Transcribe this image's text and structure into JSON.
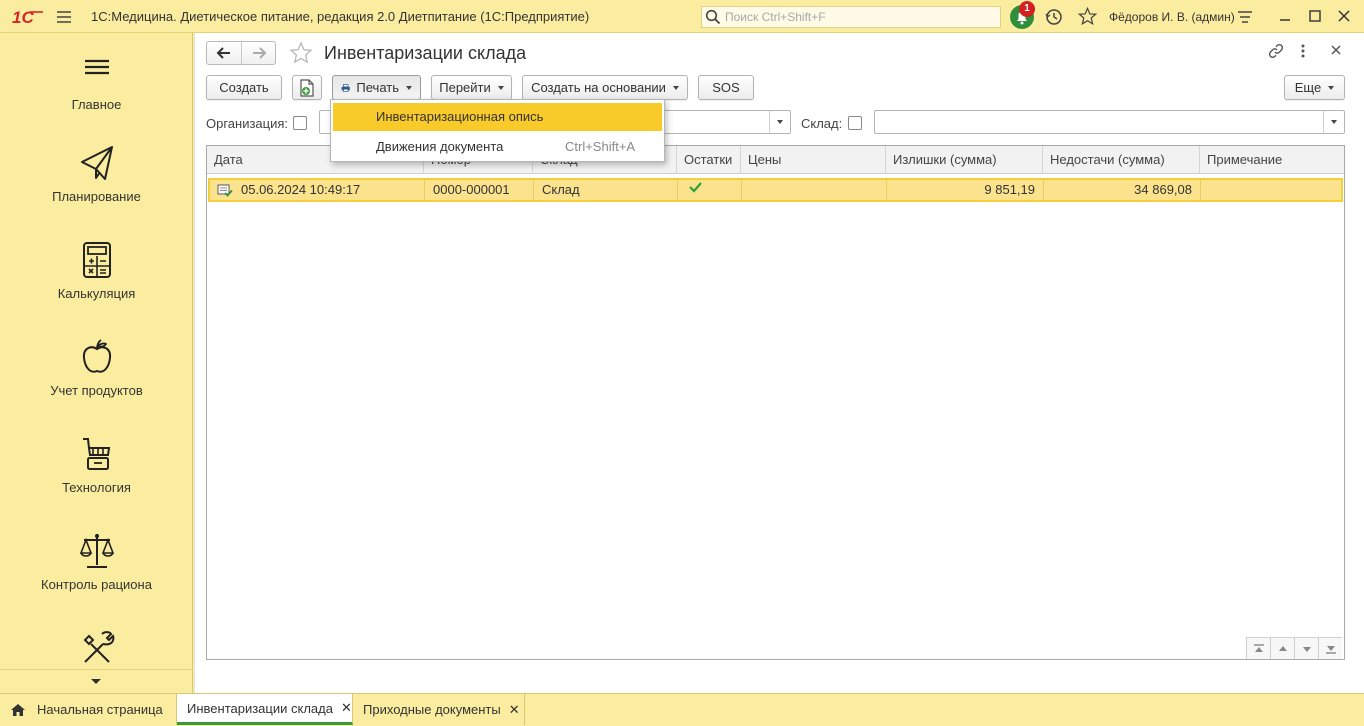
{
  "app": {
    "title": "1С:Медицина. Диетическое питание, редакция 2.0 Диетпитание  (1С:Предприятие)",
    "search_placeholder": "Поиск Ctrl+Shift+F",
    "notifications_count": "1",
    "user": "Фёдоров И. В. (админ)"
  },
  "sidebar": {
    "items": [
      {
        "label": "Главное",
        "icon": "menu-icon"
      },
      {
        "label": "Планирование",
        "icon": "paper-plane-icon"
      },
      {
        "label": "Калькуляция",
        "icon": "calculator-icon"
      },
      {
        "label": "Учет продуктов",
        "icon": "apple-icon"
      },
      {
        "label": "Технология",
        "icon": "cart-icon"
      },
      {
        "label": "Контроль рациона",
        "icon": "scales-icon"
      },
      {
        "label": "",
        "icon": "tools-icon"
      }
    ]
  },
  "page": {
    "title": "Инвентаризации склада"
  },
  "toolbar": {
    "create": "Создать",
    "print": "Печать",
    "goto": "Перейти",
    "create_based": "Создать на основании",
    "sos": "SOS",
    "more": "Еще"
  },
  "filters": {
    "organization_label": "Организация:",
    "warehouse_label": "Склад:",
    "organization_value": "",
    "warehouse_value": ""
  },
  "print_menu": {
    "items": [
      {
        "label": "Инвентаризационная опись",
        "shortcut": ""
      },
      {
        "label": "Движения документа",
        "shortcut": "Ctrl+Shift+A"
      }
    ]
  },
  "table": {
    "columns": [
      "Дата",
      "Номер",
      "Склад",
      "Остатки",
      "Цены",
      "Излишки (сумма)",
      "Недостачи (сумма)",
      "Примечание"
    ],
    "rows": [
      {
        "date": "05.06.2024 10:49:17",
        "number": "0000-000001",
        "warehouse": "Склад",
        "balance_checked": true,
        "prices": "",
        "surplus": "9 851,19",
        "shortage": "34 869,08",
        "note": ""
      }
    ]
  },
  "tabs": [
    {
      "label": "Начальная страница"
    },
    {
      "label": "Инвентаризации склада"
    },
    {
      "label": "Приходные документы"
    }
  ],
  "colors": {
    "shell": "#fbeda0",
    "selection": "#fbe38e",
    "menu_highlight": "#f8cb2a",
    "active_tab_underline": "#3a9b3a",
    "badge": "#d32020"
  }
}
